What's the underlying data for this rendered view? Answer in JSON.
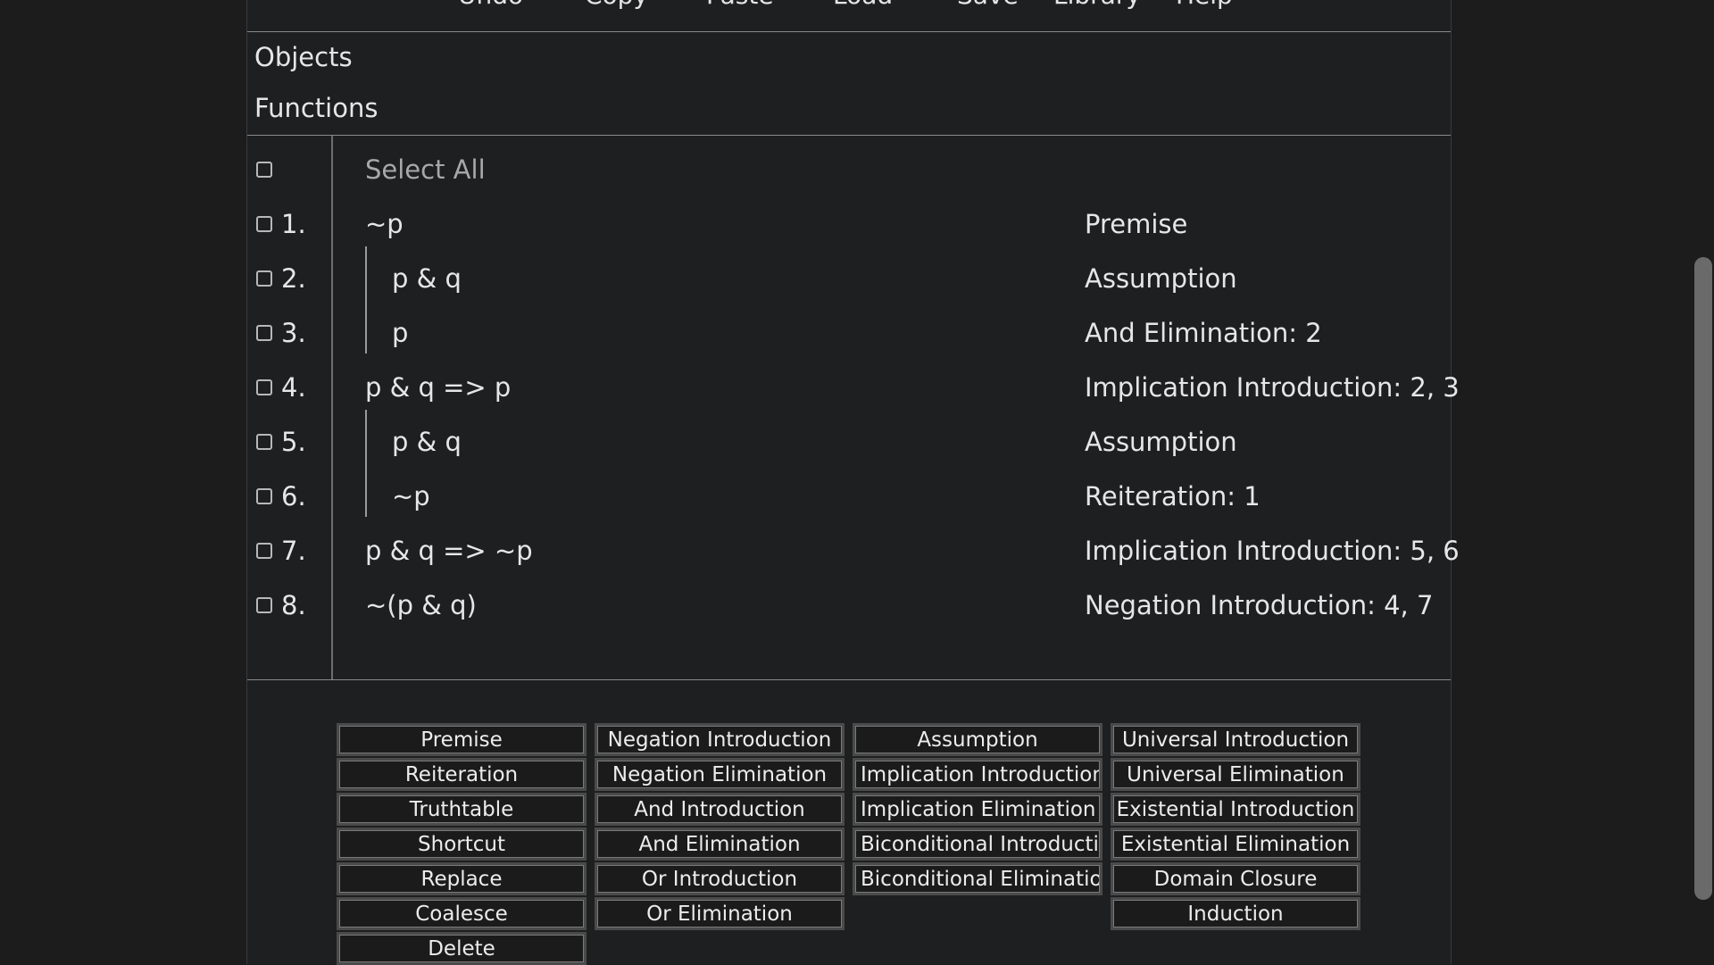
{
  "menu": [
    "Undo",
    "Copy",
    "Paste",
    "Load",
    "Save",
    "Library",
    "Help"
  ],
  "sections": {
    "objects": "Objects",
    "functions": "Functions"
  },
  "proof": {
    "select_all": "Select All",
    "lines": [
      {
        "num": "1.",
        "formula": "~p",
        "justification": "Premise"
      },
      {
        "num": "2.",
        "formula": "p & q",
        "justification": "Assumption"
      },
      {
        "num": "3.",
        "formula": "p",
        "justification": "And Elimination: 2"
      },
      {
        "num": "4.",
        "formula": "p & q => p",
        "justification": "Implication Introduction: 2, 3"
      },
      {
        "num": "5.",
        "formula": "p & q",
        "justification": "Assumption"
      },
      {
        "num": "6.",
        "formula": "~p",
        "justification": "Reiteration: 1"
      },
      {
        "num": "7.",
        "formula": "p & q => ~p",
        "justification": "Implication Introduction: 5, 6"
      },
      {
        "num": "8.",
        "formula": "~(p & q)",
        "justification": "Negation Introduction: 4, 7"
      }
    ]
  },
  "rules": {
    "col1": [
      "Premise",
      "Reiteration",
      "Truthtable",
      "Shortcut",
      "Replace",
      "Coalesce",
      "Delete"
    ],
    "col2": [
      "Negation Introduction",
      "Negation Elimination",
      "And Introduction",
      "And Elimination",
      "Or Introduction",
      "Or Elimination"
    ],
    "col3": [
      "Assumption",
      "Implication Introduction",
      "Implication Elimination",
      "Biconditional Introduction",
      "Biconditional Elimination"
    ],
    "col4": [
      "Universal Introduction",
      "Universal Elimination",
      "Existential Introduction",
      "Existential Elimination",
      "Domain Closure",
      "Induction"
    ]
  },
  "colors": {
    "background": "#1c1c1c",
    "panel": "#1e1f20",
    "text": "#e6e6e6"
  }
}
